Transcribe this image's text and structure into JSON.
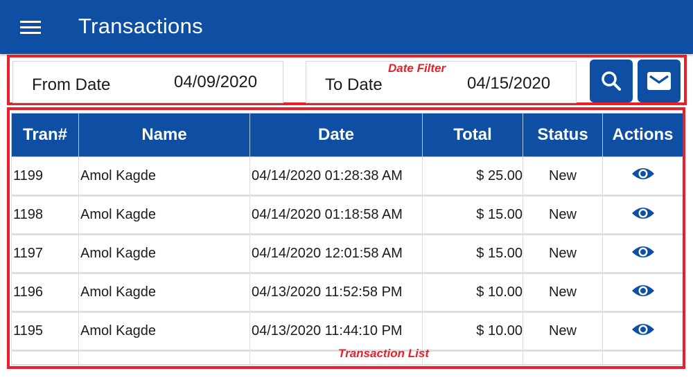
{
  "appbar": {
    "title": "Transactions",
    "menu_icon": "hamburger-menu-icon"
  },
  "filter": {
    "caption": "Date Filter",
    "from_label": "From Date",
    "from_value": "04/09/2020",
    "to_label": "To Date",
    "to_value": "04/15/2020",
    "search_icon": "search-icon",
    "email_icon": "mail-icon"
  },
  "table": {
    "caption": "Transaction List",
    "columns": [
      "Tran#",
      "Name",
      "Date",
      "Total",
      "Status",
      "Actions"
    ],
    "rows": [
      {
        "tran": "1199",
        "name": "Amol Kagde",
        "date": "04/14/2020 01:28:38 AM",
        "total": "$ 25.00",
        "status": "New",
        "action_icon": "eye-icon"
      },
      {
        "tran": "1198",
        "name": "Amol Kagde",
        "date": "04/14/2020 01:18:58 AM",
        "total": "$ 15.00",
        "status": "New",
        "action_icon": "eye-icon"
      },
      {
        "tran": "1197",
        "name": "Amol Kagde",
        "date": "04/14/2020 12:01:58 AM",
        "total": "$ 15.00",
        "status": "New",
        "action_icon": "eye-icon"
      },
      {
        "tran": "1196",
        "name": "Amol Kagde",
        "date": "04/13/2020 11:52:58 PM",
        "total": "$ 10.00",
        "status": "New",
        "action_icon": "eye-icon"
      },
      {
        "tran": "1195",
        "name": "Amol Kagde",
        "date": "04/13/2020 11:44:10 PM",
        "total": "$ 10.00",
        "status": "New",
        "action_icon": "eye-icon"
      }
    ]
  },
  "colors": {
    "primary": "#0e4fa3",
    "annotation": "#e8202a"
  }
}
